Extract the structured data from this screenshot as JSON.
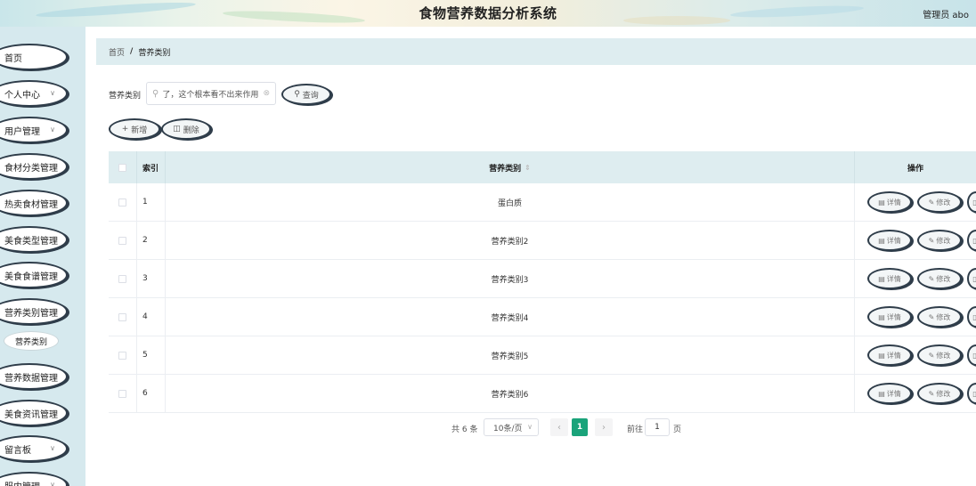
{
  "header": {
    "title": "食物营养数据分析系统",
    "user": "管理员 abo"
  },
  "sidebar": {
    "items": [
      {
        "label": "首页",
        "has_arrow": false
      },
      {
        "label": "个人中心",
        "has_arrow": true
      },
      {
        "label": "用户管理",
        "has_arrow": true
      },
      {
        "label": "食材分类管理",
        "has_arrow": false
      },
      {
        "label": "热卖食材管理",
        "has_arrow": false
      },
      {
        "label": "美食类型管理",
        "has_arrow": false
      },
      {
        "label": "美食食谱管理",
        "has_arrow": false
      },
      {
        "label": "营养类别管理",
        "has_arrow": false
      },
      {
        "label": "营养数据管理",
        "has_arrow": false
      },
      {
        "label": "美食资讯管理",
        "has_arrow": false
      },
      {
        "label": "留言板",
        "has_arrow": true
      },
      {
        "label": "服内管理",
        "has_arrow": true
      }
    ],
    "active_sub": "营养类别"
  },
  "breadcrumb": {
    "home": "首页",
    "separator": "/",
    "current": "营养类别"
  },
  "search": {
    "label": "营养类别",
    "value": "了，这个根本看不出来作用",
    "button": "查询"
  },
  "actions": {
    "add": "新增",
    "delete": "删除"
  },
  "table": {
    "columns": {
      "index": "索引",
      "name": "营养类别",
      "ops": "操作"
    },
    "rows": [
      {
        "index": "1",
        "name": "蛋白质"
      },
      {
        "index": "2",
        "name": "营养类别2"
      },
      {
        "index": "3",
        "name": "营养类别3"
      },
      {
        "index": "4",
        "name": "营养类别4"
      },
      {
        "index": "5",
        "name": "营养类别5"
      },
      {
        "index": "6",
        "name": "营养类别6"
      }
    ],
    "row_buttons": {
      "detail": "详情",
      "edit": "修改"
    }
  },
  "pagination": {
    "total": "共 6 条",
    "page_size": "10条/页",
    "current": "1",
    "goto_prefix": "前往",
    "goto_value": "1",
    "goto_suffix": "页"
  },
  "colors": {
    "accent": "#1aa37a",
    "sidebar_bg": "#d6e9ee",
    "outline": "#2f3d4a"
  }
}
